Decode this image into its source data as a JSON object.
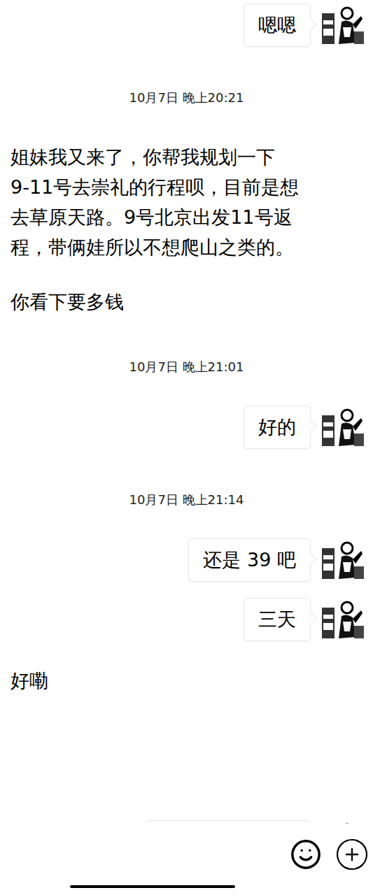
{
  "messages": [
    {
      "kind": "bubble",
      "side": "right",
      "text": "嗯嗯"
    },
    {
      "kind": "time",
      "text": "10月7日 晚上20:21"
    },
    {
      "kind": "plain",
      "side": "left",
      "paragraphs": [
        [
          "姐妹我又来了，你帮我规划一下",
          "9-11号去崇礼的行程呗，目前是想",
          "去草原天路。9号北京出发11号返",
          "程，带俩娃所以不想爬山之类的。"
        ],
        [
          "你看下要多钱"
        ]
      ]
    },
    {
      "kind": "time",
      "text": "10月7日 晚上21:01"
    },
    {
      "kind": "bubble",
      "side": "right",
      "text": "好的"
    },
    {
      "kind": "time",
      "text": "10月7日 晚上21:14"
    },
    {
      "kind": "bubble",
      "side": "right",
      "text": "还是 39 吧"
    },
    {
      "kind": "bubble",
      "side": "right",
      "text": "三天"
    },
    {
      "kind": "plain",
      "side": "left",
      "paragraphs": [
        [
          "好嘞"
        ]
      ]
    },
    {
      "kind": "partial",
      "side": "right"
    }
  ]
}
